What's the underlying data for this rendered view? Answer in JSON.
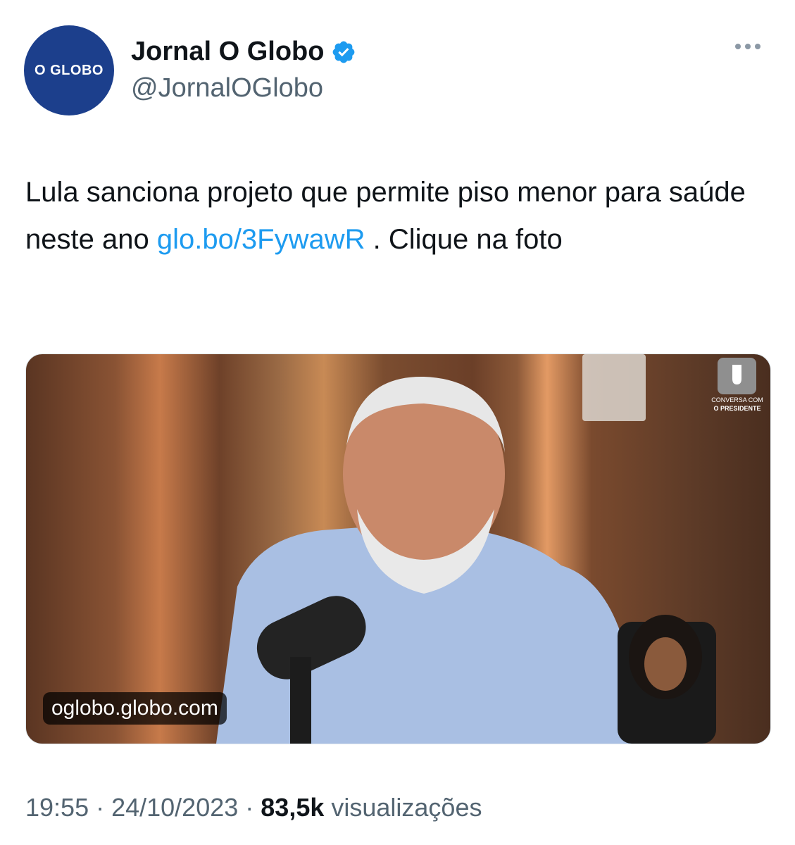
{
  "account": {
    "avatar_text": "O GLOBO",
    "display_name": "Jornal O Globo",
    "handle": "@JornalOGlobo",
    "verified_icon": "verified-badge-icon",
    "menu_icon": "more-options-icon"
  },
  "tweet": {
    "text_part1": "Lula sanciona projeto que permite piso menor para saúde neste ano ",
    "link": "glo.bo/3FywawR",
    "text_part2": " . Clique na foto"
  },
  "media": {
    "domain": "oglobo.globo.com",
    "watermark_line1": "CONVERSA COM",
    "watermark_line2": "O PRESIDENTE"
  },
  "meta": {
    "time": "19:55",
    "sep1": " · ",
    "date": "24/10/2023",
    "sep2": " · ",
    "views_count": "83,5k",
    "views_label": " visualizações"
  },
  "colors": {
    "avatar_bg": "#1c3f8c",
    "link": "#1d9bf0",
    "verified": "#1d9bf0",
    "secondary_text": "#536471"
  }
}
